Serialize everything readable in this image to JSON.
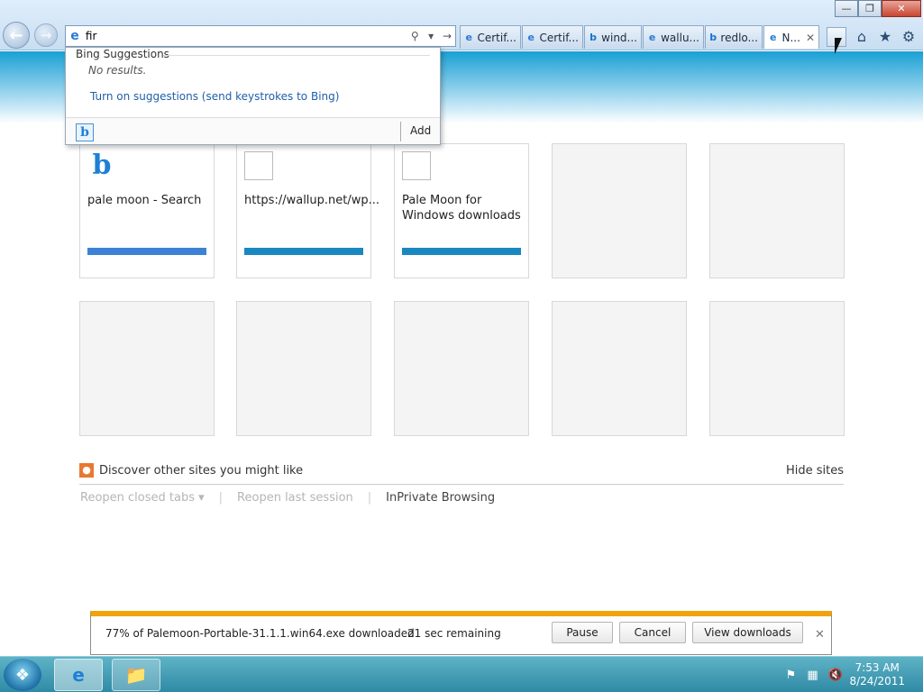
{
  "window": {
    "minimize_icon": "minimize-icon",
    "restore_icon": "restore-icon",
    "close_icon": "close-icon"
  },
  "navigation": {
    "back_icon": "arrow-left-icon",
    "forward_icon": "arrow-right-icon"
  },
  "address_bar": {
    "value": "fir",
    "site_icon": "ie-icon",
    "search_icon": "search-icon",
    "dropdown_icon": "chevron-down-icon",
    "go_icon": "arrow-right-icon"
  },
  "tabs": [
    {
      "label": "Certif...",
      "icon": "ie-icon"
    },
    {
      "label": "Certif...",
      "icon": "ie-icon"
    },
    {
      "label": "wind...",
      "icon": "bing-icon"
    },
    {
      "label": "wallu...",
      "icon": "ie-icon"
    },
    {
      "label": "redlo...",
      "icon": "bing-icon"
    },
    {
      "label": "N...",
      "icon": "ie-icon",
      "active": true
    }
  ],
  "command_icons": [
    "home-icon",
    "star-icon",
    "gear-icon"
  ],
  "suggestions": {
    "header": "Bing Suggestions",
    "no_results": "No results.",
    "turn_on": "Turn on suggestions (send keystrokes to Bing)",
    "add_label": "Add",
    "provider_icon": "bing-icon"
  },
  "tiles": [
    {
      "title": "pale moon - Search",
      "icon": "bing-icon",
      "bar_color": "#3c82d4"
    },
    {
      "title": "https://wallup.net/wp...",
      "icon": "blank-icon",
      "bar_color": "#1a88c0"
    },
    {
      "title": "Pale Moon for Windows downloads",
      "icon": "blank-icon",
      "bar_color": "#1a88c0"
    }
  ],
  "discover": {
    "label": "Discover other sites you might like",
    "hide": "Hide sites"
  },
  "links": {
    "reopen_tabs": "Reopen closed tabs",
    "reopen_session": "Reopen last session",
    "inprivate": "InPrivate Browsing"
  },
  "download": {
    "message": "77% of Palemoon-Portable-31.1.1.win64.exe downloaded",
    "progress": 0.77,
    "remaining": "21 sec remaining",
    "pause": "Pause",
    "cancel": "Cancel",
    "view": "View downloads",
    "accent": "#f0a30a"
  },
  "taskbar": {
    "time": "7:53 AM",
    "date": "8/24/2011"
  }
}
